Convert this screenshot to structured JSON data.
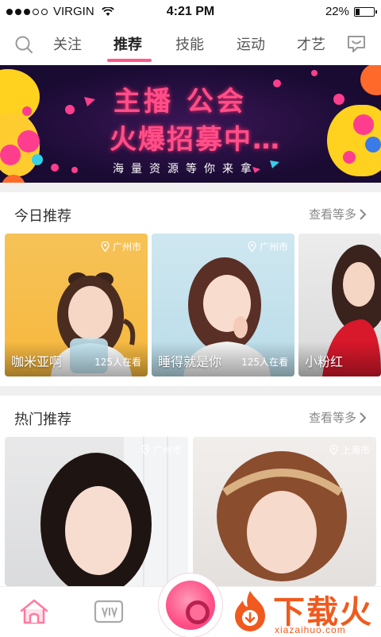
{
  "status_bar": {
    "carrier": "VIRGIN",
    "time": "4:21 PM",
    "battery": "22%",
    "battery_level": 0.22
  },
  "nav": {
    "tabs": [
      {
        "label": "关注",
        "active": false
      },
      {
        "label": "推荐",
        "active": true
      },
      {
        "label": "技能",
        "active": false
      },
      {
        "label": "运动",
        "active": false
      },
      {
        "label": "才艺",
        "active": false
      }
    ],
    "accent_color": "#ff5a8a"
  },
  "banner": {
    "line1": "主播 公会",
    "line2": "火爆招募中…",
    "line3": "海量资源等你来拿"
  },
  "today": {
    "title": "今日推荐",
    "more": "查看等多",
    "cards": [
      {
        "location": "广州市",
        "name": "咖米亚啊",
        "viewers": "125人在看"
      },
      {
        "location": "广州市",
        "name": "睡得就是你",
        "viewers": "125人在看"
      },
      {
        "location": "",
        "name": "小粉红",
        "viewers": ""
      }
    ]
  },
  "hot": {
    "title": "热门推荐",
    "more": "查看等多",
    "cards": [
      {
        "location": "广州市"
      },
      {
        "location": "上海市"
      }
    ]
  },
  "watermark": {
    "text": "下载火",
    "url": "xiazaihuo.com"
  },
  "icons": [
    "search-icon",
    "chat-icon",
    "home-icon",
    "video-icon",
    "camera-icon",
    "location-pin-icon",
    "chevron-right-icon"
  ]
}
